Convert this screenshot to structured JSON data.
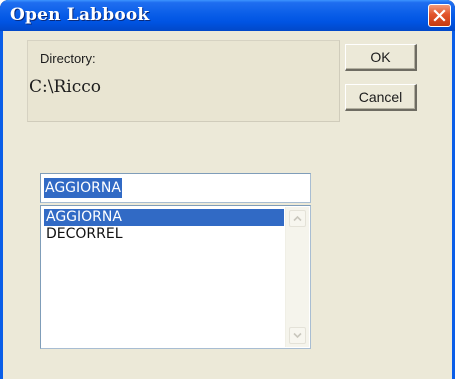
{
  "window": {
    "title": "Open Labbook"
  },
  "directory": {
    "label": "Directory:",
    "value": "C:\\Ricco"
  },
  "buttons": {
    "ok_label": "OK",
    "cancel_label": "Cancel"
  },
  "name_field": {
    "value": "AGGIORNA"
  },
  "list": {
    "items": [
      {
        "label": "AGGIORNA",
        "selected": true
      },
      {
        "label": "DECORREL",
        "selected": false
      }
    ]
  },
  "colors": {
    "titlebar": "#0054e3",
    "selection": "#316ac5",
    "dialog_face": "#ece9d8",
    "close_button": "#e2542b"
  },
  "icons": {
    "close": "close-icon",
    "scroll_up": "chevron-up-icon",
    "scroll_down": "chevron-down-icon"
  }
}
